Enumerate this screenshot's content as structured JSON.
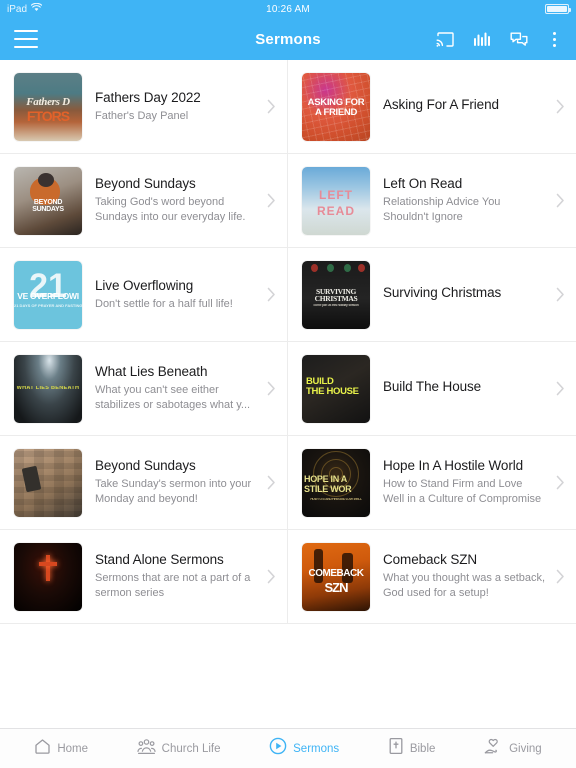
{
  "statusbar": {
    "device": "iPad",
    "wifi_icon": "wifi-icon",
    "time": "10:26 AM",
    "battery_icon": "battery-full-icon"
  },
  "navbar": {
    "menu_icon": "hamburger-menu-icon",
    "title": "Sermons",
    "actions": [
      {
        "name": "cast-icon",
        "label": "Cast"
      },
      {
        "name": "audio-bars-icon",
        "label": "Audio"
      },
      {
        "name": "chat-bubbles-icon",
        "label": "Chat"
      },
      {
        "name": "overflow-menu-icon",
        "label": "More"
      }
    ]
  },
  "sermons": [
    {
      "title": "Fathers Day 2022",
      "subtitle": "Father's Day  Panel",
      "art": "art-fathers",
      "art_lines": [
        "Fathers D",
        "FTORS"
      ]
    },
    {
      "title": "Asking For A Friend",
      "subtitle": "",
      "art": "art-asking",
      "art_lines": [
        "ASKING FOR",
        "A FRIEND"
      ]
    },
    {
      "title": "Beyond Sundays",
      "subtitle": "Taking God's word beyond Sundays into our everyday life.",
      "art": "art-beyond1",
      "art_lines": [
        "BEYOND",
        "SUNDAYS"
      ]
    },
    {
      "title": "Left On Read",
      "subtitle": "Relationship Advice You Shouldn't Ignore",
      "art": "art-left",
      "art_lines": [
        "LEFT",
        "READ"
      ]
    },
    {
      "title": "Live Overflowing",
      "subtitle": "Don't settle for a half full life!",
      "art": "art-live",
      "art_lines": [
        "VE OVERFLOWI",
        "21 DAYS OF PRAYER AND FASTING"
      ],
      "art_big": "21"
    },
    {
      "title": "Surviving Christmas",
      "subtitle": "",
      "art": "art-xmas",
      "art_lines": [
        "SURVIVING",
        "CHRISTMAS",
        "come join us this holiday season"
      ]
    },
    {
      "title": "What Lies Beneath",
      "subtitle": "What you can't see either stabilizes or sabotages what y...",
      "art": "art-wlb",
      "art_lines": [
        "WHAT LIES BENEATH"
      ]
    },
    {
      "title": "Build The House",
      "subtitle": "",
      "art": "art-build",
      "art_lines": [
        "BUILD",
        "THE HOUSE"
      ]
    },
    {
      "title": "Beyond Sundays",
      "subtitle": "Take Sunday's sermon into your Monday and beyond!",
      "art": "art-beyond2",
      "art_lines": []
    },
    {
      "title": "Hope In A Hostile World",
      "subtitle": "How to Stand Firm and Love Well in a Culture of Compromise",
      "art": "art-hope",
      "art_lines": [
        "HOPE IN A",
        "STILE WOR",
        "HOW TO STAND FIRM AND LOVE WELL"
      ]
    },
    {
      "title": "Stand Alone Sermons",
      "subtitle": "Sermons that are not a part of a sermon series",
      "art": "art-stand",
      "art_lines": []
    },
    {
      "title": "Comeback SZN",
      "subtitle": "What you thought was a setback, God used for a setup!",
      "art": "art-comeback",
      "art_lines": [
        "COMEBACK",
        "SZN"
      ]
    }
  ],
  "chevron_icon": "chevron-right-icon",
  "tabbar": {
    "items": [
      {
        "label": "Home",
        "icon": "home-icon",
        "active": false
      },
      {
        "label": "Church Life",
        "icon": "people-group-icon",
        "active": false
      },
      {
        "label": "Sermons",
        "icon": "play-circle-icon",
        "active": true
      },
      {
        "label": "Bible",
        "icon": "bible-book-icon",
        "active": false
      },
      {
        "label": "Giving",
        "icon": "hand-heart-icon",
        "active": false
      }
    ]
  },
  "colors": {
    "accent": "#3fb4f5",
    "title_text": "#1c1c1e",
    "sub_text": "#8e8e93",
    "divider": "#ececec"
  }
}
